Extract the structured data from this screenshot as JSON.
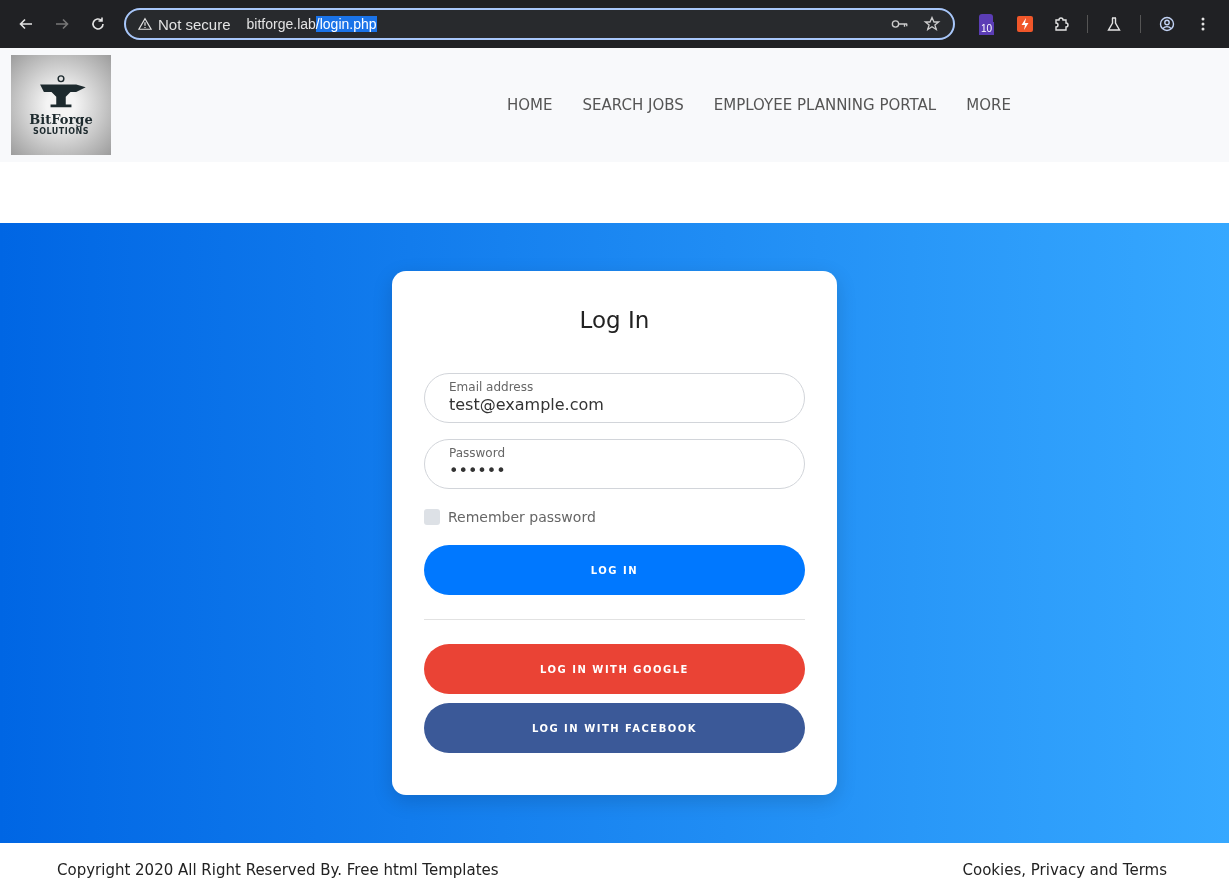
{
  "browser": {
    "security": "Not secure",
    "url_host": "bitforge.lab",
    "url_path": "/login.php",
    "url_path_selected": true,
    "extension_badge": "10"
  },
  "logo": {
    "name": "BitForge",
    "tagline": "SOLUTIONS"
  },
  "nav": [
    {
      "label": "HOME"
    },
    {
      "label": "SEARCH JOBS"
    },
    {
      "label": "EMPLOYEE PLANNING PORTAL"
    },
    {
      "label": "MORE"
    }
  ],
  "login": {
    "title": "Log In",
    "fields": [
      {
        "label": "Email address",
        "value": "test@example.com"
      },
      {
        "label": "Password",
        "value": "••••••"
      }
    ],
    "remember": {
      "label": "Remember password",
      "checked": false
    },
    "buttons": [
      {
        "label": "LOG IN",
        "kind": "primary"
      },
      {
        "label": "LOG IN WITH GOOGLE",
        "kind": "google"
      },
      {
        "label": "LOG IN WITH FACEBOOK",
        "kind": "facebook"
      }
    ]
  },
  "footer": {
    "copyright": "Copyright 2020 All Right Reserved By. Free html Templates",
    "links": "Cookies, Privacy and Terms"
  }
}
